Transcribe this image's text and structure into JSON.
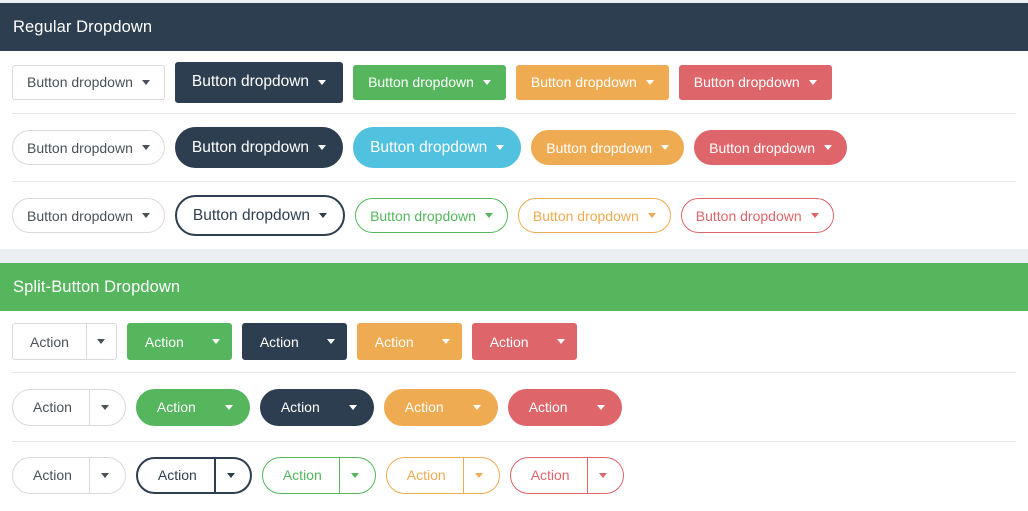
{
  "sections": [
    {
      "id": "regular-dropdown",
      "title": "Regular Dropdown",
      "header_color": "#2d3e50",
      "rows": [
        {
          "id": "regular-row-square",
          "shape": "square",
          "style": "solid",
          "buttons": [
            {
              "label": "Button dropdown",
              "variant": "default",
              "size": "normal",
              "caret": "caret-down-icon"
            },
            {
              "label": "Button dropdown",
              "variant": "dark",
              "size": "large",
              "caret": "caret-down-icon"
            },
            {
              "label": "Button dropdown",
              "variant": "green",
              "size": "normal",
              "caret": "caret-down-icon"
            },
            {
              "label": "Button dropdown",
              "variant": "orange",
              "size": "normal",
              "caret": "caret-down-icon"
            },
            {
              "label": "Button dropdown",
              "variant": "red",
              "size": "normal",
              "caret": "caret-down-icon"
            }
          ]
        },
        {
          "id": "regular-row-pill",
          "shape": "pill",
          "style": "solid",
          "buttons": [
            {
              "label": "Button dropdown",
              "variant": "default",
              "size": "normal",
              "caret": "caret-down-icon"
            },
            {
              "label": "Button dropdown",
              "variant": "dark",
              "size": "large",
              "caret": "caret-down-icon"
            },
            {
              "label": "Button dropdown",
              "variant": "cyan",
              "size": "large",
              "caret": "caret-down-icon"
            },
            {
              "label": "Button dropdown",
              "variant": "orange",
              "size": "normal",
              "caret": "caret-down-icon"
            },
            {
              "label": "Button dropdown",
              "variant": "red",
              "size": "normal",
              "caret": "caret-down-icon"
            }
          ]
        },
        {
          "id": "regular-row-outline",
          "shape": "pill",
          "style": "outline",
          "buttons": [
            {
              "label": "Button dropdown",
              "variant": "default",
              "size": "normal",
              "caret": "caret-down-icon"
            },
            {
              "label": "Button dropdown",
              "variant": "dark",
              "size": "large",
              "caret": "caret-down-icon"
            },
            {
              "label": "Button dropdown",
              "variant": "green",
              "size": "normal",
              "caret": "caret-down-icon"
            },
            {
              "label": "Button dropdown",
              "variant": "orange",
              "size": "normal",
              "caret": "caret-down-icon"
            },
            {
              "label": "Button dropdown",
              "variant": "red",
              "size": "normal",
              "caret": "caret-down-icon"
            }
          ]
        }
      ]
    },
    {
      "id": "split-button-dropdown",
      "title": "Split-Button Dropdown",
      "header_color": "#55b65d",
      "rows": [
        {
          "id": "split-row-square",
          "shape": "square",
          "style": "solid",
          "buttons": [
            {
              "label": "Action",
              "variant": "default",
              "caret": "caret-down-icon"
            },
            {
              "label": "Action",
              "variant": "green",
              "caret": "caret-down-icon"
            },
            {
              "label": "Action",
              "variant": "dark",
              "caret": "caret-down-icon"
            },
            {
              "label": "Action",
              "variant": "orange",
              "caret": "caret-down-icon"
            },
            {
              "label": "Action",
              "variant": "red",
              "caret": "caret-down-icon"
            }
          ]
        },
        {
          "id": "split-row-pill",
          "shape": "pill",
          "style": "solid",
          "buttons": [
            {
              "label": "Action",
              "variant": "default",
              "caret": "caret-down-icon"
            },
            {
              "label": "Action",
              "variant": "green",
              "caret": "caret-down-icon"
            },
            {
              "label": "Action",
              "variant": "dark",
              "caret": "caret-down-icon"
            },
            {
              "label": "Action",
              "variant": "orange",
              "caret": "caret-down-icon"
            },
            {
              "label": "Action",
              "variant": "red",
              "caret": "caret-down-icon"
            }
          ]
        },
        {
          "id": "split-row-outline",
          "shape": "pill",
          "style": "outline",
          "buttons": [
            {
              "label": "Action",
              "variant": "default",
              "caret": "caret-down-icon"
            },
            {
              "label": "Action",
              "variant": "dark",
              "caret": "caret-down-icon"
            },
            {
              "label": "Action",
              "variant": "green",
              "caret": "caret-down-icon"
            },
            {
              "label": "Action",
              "variant": "orange",
              "caret": "caret-down-icon"
            },
            {
              "label": "Action",
              "variant": "red",
              "caret": "caret-down-icon"
            }
          ]
        }
      ]
    }
  ],
  "palette": {
    "dark": "#2d3e50",
    "green": "#55b65d",
    "cyan": "#50c1de",
    "orange": "#efab51",
    "red": "#de6569",
    "default_border": "#d6dadc",
    "page_gap": "#eceff1"
  }
}
